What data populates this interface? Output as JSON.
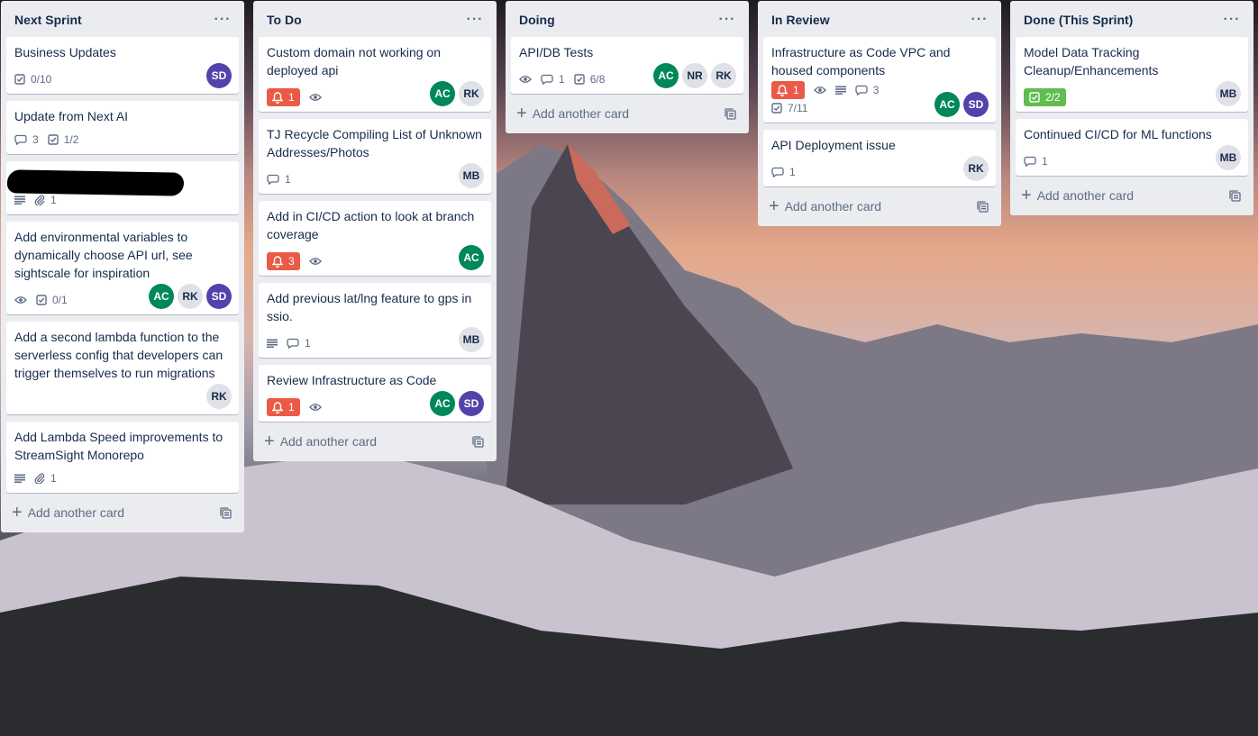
{
  "colors": {
    "list_bg": "#ebecf0",
    "card_bg": "#ffffff",
    "badge_overdue": "#eb5a46",
    "badge_complete": "#61bd4f",
    "text_main": "#172b4d",
    "text_muted": "#5e6c84",
    "member_colors": {
      "SD": "#5243aa",
      "AC": "#00875a",
      "RK": "#dfe1e6",
      "MB": "#dfe1e6",
      "NR": "#dfe1e6"
    },
    "member_text": {
      "SD": "#ffffff",
      "AC": "#ffffff",
      "RK": "#172b4d",
      "MB": "#172b4d",
      "NR": "#172b4d"
    }
  },
  "lists": [
    {
      "title": "Next Sprint",
      "menu_icon": "more-horizontal-icon",
      "add_label": "Add another card",
      "cards": [
        {
          "title": "Business Updates",
          "badges": [
            {
              "icon": "checklist-icon",
              "text": "0/10"
            }
          ],
          "members": [
            "SD"
          ]
        },
        {
          "title": "Update from Next AI",
          "badges": [
            {
              "icon": "comment-icon",
              "text": "3"
            },
            {
              "icon": "checklist-icon",
              "text": "1/2"
            }
          ],
          "members": []
        },
        {
          "title": "",
          "redacted": true,
          "badges": [
            {
              "icon": "description-icon",
              "text": ""
            },
            {
              "icon": "attachment-icon",
              "text": "1"
            }
          ],
          "members": []
        },
        {
          "title": "Add environmental variables to dynamically choose API url, see sightscale for inspiration",
          "badges": [
            {
              "icon": "eye-icon",
              "text": ""
            },
            {
              "icon": "checklist-icon",
              "text": "0/1"
            }
          ],
          "members": [
            "AC",
            "RK",
            "SD"
          ]
        },
        {
          "title": "Add a second lambda function to the serverless config that developers can trigger themselves to run migrations",
          "badges": [],
          "members": [
            "RK"
          ]
        },
        {
          "title": "Add Lambda Speed improvements to StreamSight Monorepo",
          "badges": [
            {
              "icon": "description-icon",
              "text": ""
            },
            {
              "icon": "attachment-icon",
              "text": "1"
            }
          ],
          "members": []
        }
      ]
    },
    {
      "title": "To Do",
      "menu_icon": "more-horizontal-icon",
      "add_label": "Add another card",
      "cards": [
        {
          "title": "Custom domain not working on deployed api",
          "badges": [
            {
              "icon": "bell-icon",
              "text": "1",
              "style": "red"
            },
            {
              "icon": "eye-icon",
              "text": ""
            }
          ],
          "members": [
            "AC",
            "RK"
          ]
        },
        {
          "title": "TJ Recycle Compiling List of Unknown Addresses/Photos",
          "badges": [
            {
              "icon": "comment-icon",
              "text": "1"
            }
          ],
          "members": [
            "MB"
          ]
        },
        {
          "title": "Add in CI/CD action to look at branch coverage",
          "badges": [
            {
              "icon": "bell-icon",
              "text": "3",
              "style": "red"
            },
            {
              "icon": "eye-icon",
              "text": ""
            }
          ],
          "members": [
            "AC"
          ]
        },
        {
          "title": "Add previous lat/lng feature to gps in ssio.",
          "badges": [
            {
              "icon": "description-icon",
              "text": ""
            },
            {
              "icon": "comment-icon",
              "text": "1"
            }
          ],
          "members": [
            "MB"
          ]
        },
        {
          "title": "Review Infrastructure as Code",
          "badges": [
            {
              "icon": "bell-icon",
              "text": "1",
              "style": "red"
            },
            {
              "icon": "eye-icon",
              "text": ""
            }
          ],
          "members": [
            "AC",
            "SD"
          ]
        }
      ]
    },
    {
      "title": "Doing",
      "menu_icon": "more-horizontal-icon",
      "add_label": "Add another card",
      "cards": [
        {
          "title": "API/DB Tests",
          "badges": [
            {
              "icon": "eye-icon",
              "text": ""
            },
            {
              "icon": "comment-icon",
              "text": "1"
            },
            {
              "icon": "checklist-icon",
              "text": "6/8"
            }
          ],
          "members": [
            "AC",
            "NR",
            "RK"
          ]
        }
      ]
    },
    {
      "title": "In Review",
      "menu_icon": "more-horizontal-icon",
      "add_label": "Add another card",
      "cards": [
        {
          "title": "Infrastructure as Code VPC and housed components",
          "badges": [
            {
              "icon": "bell-icon",
              "text": "1",
              "style": "red"
            },
            {
              "icon": "eye-icon",
              "text": ""
            },
            {
              "icon": "description-icon",
              "text": ""
            },
            {
              "icon": "comment-icon",
              "text": "3"
            },
            {
              "icon": "checklist-icon",
              "text": "7/11"
            }
          ],
          "members": [
            "AC",
            "SD"
          ]
        },
        {
          "title": "API Deployment issue",
          "badges": [
            {
              "icon": "comment-icon",
              "text": "1"
            }
          ],
          "members": [
            "RK"
          ]
        }
      ]
    },
    {
      "title": "Done (This Sprint)",
      "menu_icon": "more-horizontal-icon",
      "add_label": "Add another card",
      "cards": [
        {
          "title": "Model Data Tracking Cleanup/Enhancements",
          "badges": [
            {
              "icon": "checklist-icon",
              "text": "2/2",
              "style": "green"
            }
          ],
          "members": [
            "MB"
          ]
        },
        {
          "title": "Continued CI/CD for ML functions",
          "badges": [
            {
              "icon": "comment-icon",
              "text": "1"
            }
          ],
          "members": [
            "MB"
          ]
        }
      ]
    }
  ]
}
